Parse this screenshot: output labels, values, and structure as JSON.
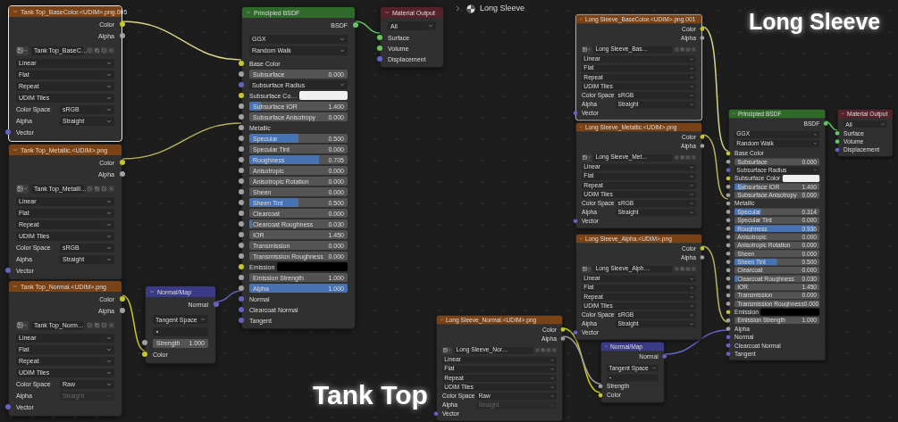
{
  "breadcrumb": {
    "text": "Long Sleeve"
  },
  "titles": [
    {
      "text": "Long Sleeve"
    },
    {
      "text": "Tank Top"
    }
  ],
  "nodes": [
    {
      "kind": "image_texture",
      "title": "Tank Top_BaseColor.<UDIM>.png.005",
      "selected": true,
      "outputs": [
        {
          "label": "Color",
          "color": "#c7c729"
        },
        {
          "label": "Alpha",
          "color": "#a1a1a1"
        }
      ],
      "image": "Tank Top_BaseC…",
      "options": [
        "Linear",
        "Flat",
        "Repeat",
        "UDIM Tiles"
      ],
      "props": [
        {
          "label": "Color Space",
          "value": "sRGB",
          "disabled": false
        },
        {
          "label": "Alpha",
          "value": "Straight",
          "disabled": false
        }
      ],
      "input": {
        "label": "Vector",
        "color": "#6363c7"
      }
    },
    {
      "kind": "image_texture",
      "title": "Tank Top_Metallic.<UDIM>.png",
      "selected": false,
      "outputs": [
        {
          "label": "Color",
          "color": "#c7c729"
        },
        {
          "label": "Alpha",
          "color": "#a1a1a1"
        }
      ],
      "image": "Tank Top_Metalli…",
      "options": [
        "Linear",
        "Flat",
        "Repeat",
        "UDIM Tiles"
      ],
      "props": [
        {
          "label": "Color Space",
          "value": "sRGB",
          "disabled": false
        },
        {
          "label": "Alpha",
          "value": "Straight",
          "disabled": false
        }
      ],
      "input": {
        "label": "Vector",
        "color": "#6363c7"
      }
    },
    {
      "kind": "image_texture",
      "title": "Tank Top_Normal.<UDIM>.png",
      "selected": false,
      "outputs": [
        {
          "label": "Color",
          "color": "#c7c729"
        },
        {
          "label": "Alpha",
          "color": "#a1a1a1"
        }
      ],
      "image": "Tank Top_Norm…",
      "options": [
        "Linear",
        "Flat",
        "Repeat",
        "UDIM Tiles"
      ],
      "props": [
        {
          "label": "Color Space",
          "value": "Raw",
          "disabled": false
        },
        {
          "label": "Alpha",
          "value": "Straight",
          "disabled": true
        }
      ],
      "input": {
        "label": "Vector",
        "color": "#6363c7"
      }
    },
    {
      "kind": "normal_map",
      "title": "Normal/Map",
      "selected": false,
      "output": "Normal",
      "space": "Tangent Space",
      "strength": {
        "label": "Strength",
        "value": "1.000"
      },
      "input": "Color"
    },
    {
      "kind": "principled",
      "title": "Principled BSDF",
      "selected": false,
      "output": "BSDF",
      "options": [
        "GGX",
        "Random Walk"
      ],
      "rows": [
        {
          "kind": "socket",
          "label": "Base Color",
          "color": "#c7c729"
        },
        {
          "kind": "slider",
          "label": "Subsurface",
          "value": "0.000",
          "color": "#a1a1a1"
        },
        {
          "kind": "dropdown",
          "label": "Subsurface Radius",
          "color": "#6363c7"
        },
        {
          "kind": "swatch",
          "label": "Subsurface Co…",
          "color": "#f0f0f0"
        },
        {
          "kind": "slider",
          "label": "Subsurface IOR",
          "value": "1.400",
          "level": 0.12,
          "color": "#a1a1a1"
        },
        {
          "kind": "slider",
          "label": "Subsurface Anisotropy",
          "value": "0.000",
          "color": "#a1a1a1"
        },
        {
          "kind": "socket",
          "label": "Metallic",
          "color": "#a1a1a1"
        },
        {
          "kind": "slider",
          "label": "Specular",
          "value": "0.500",
          "level": 0.5,
          "color": "#a1a1a1"
        },
        {
          "kind": "slider",
          "label": "Specular Tint",
          "value": "0.000",
          "color": "#a1a1a1"
        },
        {
          "kind": "slider",
          "label": "Roughness",
          "value": "0.705",
          "level": 0.705,
          "color": "#a1a1a1"
        },
        {
          "kind": "slider",
          "label": "Anisotropic",
          "value": "0.000",
          "color": "#a1a1a1"
        },
        {
          "kind": "slider",
          "label": "Anisotropic Rotation",
          "value": "0.000",
          "color": "#a1a1a1"
        },
        {
          "kind": "slider",
          "label": "Sheen",
          "value": "0.000",
          "color": "#a1a1a1"
        },
        {
          "kind": "slider",
          "label": "Sheen Tint",
          "value": "0.500",
          "level": 0.5,
          "color": "#a1a1a1"
        },
        {
          "kind": "slider",
          "label": "Clearcoat",
          "value": "0.000",
          "color": "#a1a1a1"
        },
        {
          "kind": "slider",
          "label": "Clearcoat Roughness",
          "value": "0.030",
          "level": 0.03,
          "color": "#a1a1a1"
        },
        {
          "kind": "slider",
          "label": "IOR",
          "value": "1.450",
          "color": "#a1a1a1"
        },
        {
          "kind": "slider",
          "label": "Transmission",
          "value": "0.000",
          "color": "#a1a1a1"
        },
        {
          "kind": "slider",
          "label": "Transmission Roughness",
          "value": "0.000",
          "color": "#a1a1a1"
        },
        {
          "kind": "swatch",
          "label": "Emission",
          "color": "#000000"
        },
        {
          "kind": "slider",
          "label": "Emission Strength",
          "value": "1.000",
          "color": "#a1a1a1"
        },
        {
          "kind": "slider",
          "label": "Alpha",
          "value": "1.000",
          "level": 1,
          "color": "#a1a1a1"
        },
        {
          "kind": "socket",
          "label": "Normal",
          "color": "#6363c7"
        },
        {
          "kind": "socket",
          "label": "Clearcoat Normal",
          "color": "#6363c7"
        },
        {
          "kind": "socket",
          "label": "Tangent",
          "color": "#6363c7"
        }
      ]
    },
    {
      "kind": "material_output",
      "title": "Material Output",
      "selected": false,
      "target": "All",
      "inputs": [
        {
          "label": "Surface",
          "color": "#63c763"
        },
        {
          "label": "Volume",
          "color": "#63c763"
        },
        {
          "label": "Displacement",
          "color": "#6363c7"
        }
      ]
    },
    {
      "kind": "image_texture",
      "title": "Long Sleeve_BaseColor.<UDIM>.png.001",
      "selected": true,
      "outputs": [
        {
          "label": "Color",
          "color": "#c7c729"
        },
        {
          "label": "Alpha",
          "color": "#a1a1a1"
        }
      ],
      "image": "Long Sleeve_Bas…",
      "options": [
        "Linear",
        "Flat",
        "Repeat",
        "UDIM Tiles"
      ],
      "props": [
        {
          "label": "Color Space",
          "value": "sRGB",
          "disabled": false
        },
        {
          "label": "Alpha",
          "value": "Straight",
          "disabled": false
        }
      ],
      "input": {
        "label": "Vector",
        "color": "#6363c7"
      }
    },
    {
      "kind": "image_texture",
      "title": "Long Sleeve_Metallic.<UDIM>.png",
      "selected": false,
      "outputs": [
        {
          "label": "Color",
          "color": "#c7c729"
        },
        {
          "label": "Alpha",
          "color": "#a1a1a1"
        }
      ],
      "image": "Long Sleeve_Met…",
      "options": [
        "Linear",
        "Flat",
        "Repeat",
        "UDIM Tiles"
      ],
      "props": [
        {
          "label": "Color Space",
          "value": "sRGB",
          "disabled": false
        },
        {
          "label": "Alpha",
          "value": "Straight",
          "disabled": false
        }
      ],
      "input": {
        "label": "Vector",
        "color": "#6363c7"
      }
    },
    {
      "kind": "image_texture",
      "title": "Long Sleeve_Alpha.<UDIM>.png",
      "selected": false,
      "outputs": [
        {
          "label": "Color",
          "color": "#c7c729"
        },
        {
          "label": "Alpha",
          "color": "#a1a1a1"
        }
      ],
      "image": "Long Sleeve_Alph…",
      "options": [
        "Linear",
        "Flat",
        "Repeat",
        "UDIM Tiles"
      ],
      "props": [
        {
          "label": "Color Space",
          "value": "sRGB",
          "disabled": false
        },
        {
          "label": "Alpha",
          "value": "Straight",
          "disabled": false
        }
      ],
      "input": {
        "label": "Vector",
        "color": "#6363c7"
      }
    },
    {
      "kind": "image_texture",
      "title": "Long Sleeve_Normal.<UDIM>.png",
      "selected": false,
      "outputs": [
        {
          "label": "Color",
          "color": "#c7c729"
        },
        {
          "label": "Alpha",
          "color": "#a1a1a1"
        }
      ],
      "image": "Long Sleeve_Nor…",
      "options": [
        "Linear",
        "Flat",
        "Repeat",
        "UDIM Tiles"
      ],
      "props": [
        {
          "label": "Color Space",
          "value": "Raw",
          "disabled": false
        },
        {
          "label": "Alpha",
          "value": "Straight",
          "disabled": true
        }
      ],
      "input": {
        "label": "Vector",
        "color": "#6363c7"
      }
    },
    {
      "kind": "normal_map",
      "title": "Normal/Map",
      "selected": false,
      "output": "Normal",
      "space": "Tangent Space",
      "strength": {
        "label": "Strength"
      },
      "input": "Color"
    },
    {
      "kind": "principled",
      "title": "Principled BSDF",
      "selected": false,
      "output": "BSDF",
      "options": [
        "GGX",
        "Random Walk"
      ],
      "rows": [
        {
          "kind": "socket",
          "label": "Base Color",
          "color": "#c7c729"
        },
        {
          "kind": "slider",
          "label": "Subsurface",
          "value": "0.000",
          "color": "#a1a1a1"
        },
        {
          "kind": "dropdown",
          "label": "Subsurface Radius",
          "color": "#6363c7"
        },
        {
          "kind": "swatch",
          "label": "Subsurface Color",
          "color": "#f0f0f0"
        },
        {
          "kind": "slider",
          "label": "Subsurface IOR",
          "value": "1.400",
          "level": 0.12,
          "color": "#a1a1a1"
        },
        {
          "kind": "slider",
          "label": "Subsurface Anisotropy",
          "value": "0.000",
          "color": "#a1a1a1"
        },
        {
          "kind": "socket",
          "label": "Metallic",
          "color": "#a1a1a1"
        },
        {
          "kind": "slider",
          "label": "Specular",
          "value": "0.314",
          "level": 0.314,
          "color": "#a1a1a1"
        },
        {
          "kind": "slider",
          "label": "Specular Tint",
          "value": "0.000",
          "color": "#a1a1a1"
        },
        {
          "kind": "slider",
          "label": "Roughness",
          "value": "0.936",
          "level": 0.936,
          "color": "#a1a1a1"
        },
        {
          "kind": "slider",
          "label": "Anisotropic",
          "value": "0.000",
          "color": "#a1a1a1"
        },
        {
          "kind": "slider",
          "label": "Anisotropic Rotation",
          "value": "0.000",
          "color": "#a1a1a1"
        },
        {
          "kind": "slider",
          "label": "Sheen",
          "value": "0.000",
          "color": "#a1a1a1"
        },
        {
          "kind": "slider",
          "label": "Sheen Tint",
          "value": "0.500",
          "level": 0.5,
          "color": "#a1a1a1"
        },
        {
          "kind": "slider",
          "label": "Clearcoat",
          "value": "0.000",
          "color": "#a1a1a1"
        },
        {
          "kind": "slider",
          "label": "Clearcoat Roughness",
          "value": "0.030",
          "level": 0.03,
          "color": "#a1a1a1"
        },
        {
          "kind": "slider",
          "label": "IOR",
          "value": "1.450",
          "color": "#a1a1a1"
        },
        {
          "kind": "slider",
          "label": "Transmission",
          "value": "0.000",
          "color": "#a1a1a1"
        },
        {
          "kind": "slider",
          "label": "Transmission Roughness",
          "value": "0.000",
          "color": "#a1a1a1"
        },
        {
          "kind": "swatch",
          "label": "Emission",
          "color": "#000000"
        },
        {
          "kind": "slider",
          "label": "Emission Strength",
          "value": "1.000",
          "color": "#a1a1a1"
        },
        {
          "kind": "socket",
          "label": "Alpha",
          "color": "#a1a1a1"
        },
        {
          "kind": "socket",
          "label": "Normal",
          "color": "#6363c7"
        },
        {
          "kind": "socket",
          "label": "Clearcoat Normal",
          "color": "#6363c7"
        },
        {
          "kind": "socket",
          "label": "Tangent",
          "color": "#6363c7"
        }
      ]
    },
    {
      "kind": "material_output",
      "title": "Material Output",
      "selected": false,
      "target": "All",
      "inputs": [
        {
          "label": "Surface",
          "color": "#63c763"
        },
        {
          "label": "Volume",
          "color": "#63c763"
        },
        {
          "label": "Displacement",
          "color": "#6363c7"
        }
      ]
    }
  ]
}
